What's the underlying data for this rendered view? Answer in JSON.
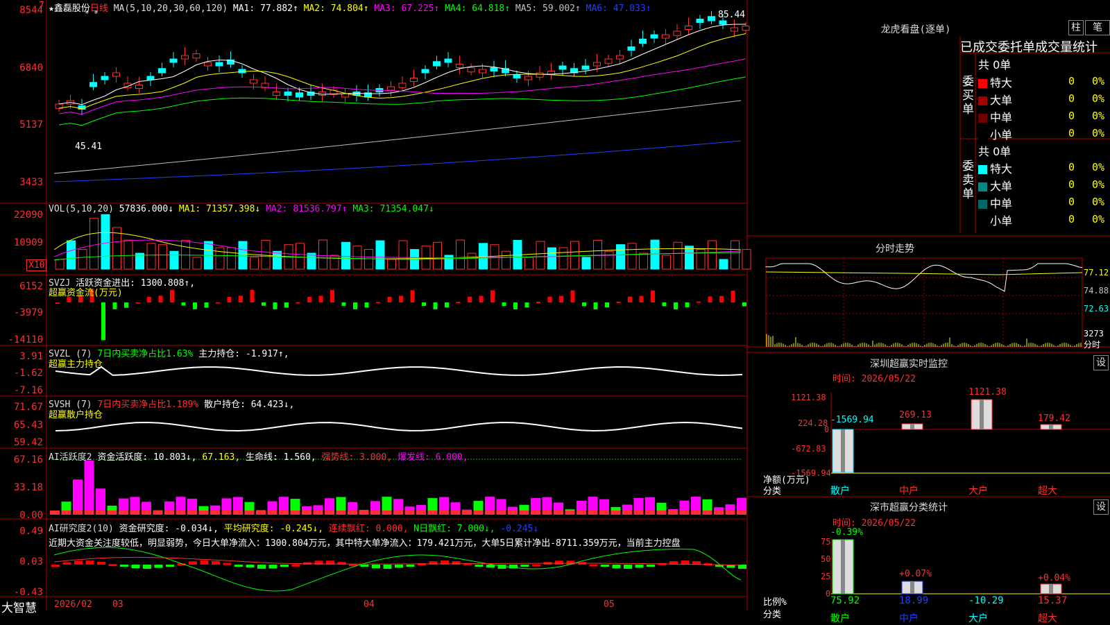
{
  "main_header": {
    "star": "★",
    "stock_name": "鑫磊股份",
    "period": "日线",
    "ma_label": "MA(5,10,20,30,60,120)",
    "ma1": "MA1: 77.882↑",
    "ma2": "MA2: 74.804↑",
    "ma3": "MA3: 67.225↑",
    "ma4": "MA4: 64.818↑",
    "ma5": "MA5: 59.002↑",
    "ma6": "MA6: 47.033↑",
    "marker": "7",
    "stars": "* *"
  },
  "price_axis": [
    "8544",
    "6840",
    "5137",
    "3433"
  ],
  "price_annotations": {
    "high": "85.44",
    "low": "45.41"
  },
  "vol_header": {
    "label": "VOL(5,10,20)",
    "value": "57836.000↓",
    "ma1": "MA1: 71357.398↓",
    "ma2": "MA2: 81536.797↑",
    "ma3": "MA3: 71354.047↓"
  },
  "vol_axis": [
    "22090",
    "10909"
  ],
  "vol_unit": "X10",
  "svzj_header": {
    "label": "SVZJ",
    "text": "活跃资金进出: 1300.808↑,",
    "sub": "超赢资金流(万元)"
  },
  "svzj_axis": [
    "6152",
    "-3979",
    "-14110"
  ],
  "svzl_header": {
    "label": "SVZL (7)",
    "text1": "7日内买卖净占比1.63%",
    "text2": "主力持仓: -1.917↑,",
    "sub": "超赢主力持仓"
  },
  "svzl_axis": [
    "3.91",
    "-1.62",
    "-7.16"
  ],
  "svsh_header": {
    "label": "SVSH (7)",
    "text1": "7日内买卖净占比1.189%",
    "text2": "散户持仓: 64.423↓,",
    "sub": "超赢散户持仓"
  },
  "svsh_axis": [
    "71.67",
    "65.43",
    "59.42"
  ],
  "ai1_header": {
    "label": "AI活跃度2",
    "t1": "资金活跃度: 10.803↓,",
    "t2": "67.163,",
    "t3": "生命线: 1.560,",
    "t4": "强势线: 3.000,",
    "t5": "爆发线: 6.000,"
  },
  "ai1_axis": [
    "67.16",
    "33.18",
    "0.00"
  ],
  "ai2_header": {
    "label": "AI研究度2(10)",
    "t1": "资金研究度: -0.034↓,",
    "t2": "平均研究度: -0.245↓,",
    "t3": "连续飘红: 0.000,",
    "t4": "N日飘红: 7.000↓,",
    "t5": "-0.245↓"
  },
  "ai2_note": "近期大资金关注度较低，明显弱势，今日大单净流入：1300.804万元，其中特大单净流入：179.421万元，大单5日累计净出-8711.359万元，当前主力控盘",
  "ai2_axis": [
    "0.49",
    "0.03",
    "-0.43"
  ],
  "bottom": {
    "logo": "大智慧",
    "dates": [
      "2026/02",
      "03",
      "04",
      "05"
    ]
  },
  "lhb": {
    "title": "龙虎看盘(逐单)",
    "btn1": "柱",
    "btn2": "笔",
    "header": "已成交委托单成交量统计",
    "buy_label": "委买单",
    "sell_label": "委卖单",
    "buy_total": "共 0单",
    "sell_total": "共 0单",
    "buy_rows": [
      {
        "name": "特大",
        "count": "0",
        "pct": "0%",
        "color": "#ff0000"
      },
      {
        "name": "大单",
        "count": "0",
        "pct": "0%",
        "color": "#a00000"
      },
      {
        "name": "中单",
        "count": "0",
        "pct": "0%",
        "color": "#700000"
      },
      {
        "name": "小单",
        "count": "0",
        "pct": "0%",
        "color": "#000000"
      }
    ],
    "sell_rows": [
      {
        "name": "特大",
        "count": "0",
        "pct": "0%",
        "color": "#00ffff"
      },
      {
        "name": "大单",
        "count": "0",
        "pct": "0%",
        "color": "#008888"
      },
      {
        "name": "中单",
        "count": "0",
        "pct": "0%",
        "color": "#006666"
      },
      {
        "name": "小单",
        "count": "0",
        "pct": "0%",
        "color": "#000000"
      }
    ]
  },
  "fenshi": {
    "title": "分时走势",
    "axis": [
      "77.12",
      "74.88",
      "72.63"
    ],
    "vol_label": "3273",
    "vol_unit": "分时"
  },
  "monitor": {
    "title": "深圳超赢实时监控",
    "btn": "设",
    "time": "时间: 2026/05/22",
    "axis": [
      "1121.38",
      "224.28",
      "0",
      "-672.83",
      "-1569.94"
    ],
    "ylabel": "净额(万元)",
    "xlabel": "分类",
    "categories": [
      "散户",
      "中户",
      "大户",
      "超大"
    ],
    "values": [
      "-1569.94",
      "269.13",
      "1121.38",
      "179.42"
    ]
  },
  "classify": {
    "title": "深市超赢分类统计",
    "btn": "设",
    "time": "时间: 2026/05/22",
    "axis": [
      "75",
      "50",
      "25",
      "0"
    ],
    "ylabel": "比例%",
    "xlabel": "分类",
    "categories": [
      "散户",
      "中户",
      "大户",
      "超大"
    ],
    "top_labels": [
      "-0.39%",
      "+0.07%",
      "",
      "+0.04%"
    ],
    "bottom_values": [
      "75.92",
      "18.99",
      "-10.29",
      "15.37"
    ]
  }
}
